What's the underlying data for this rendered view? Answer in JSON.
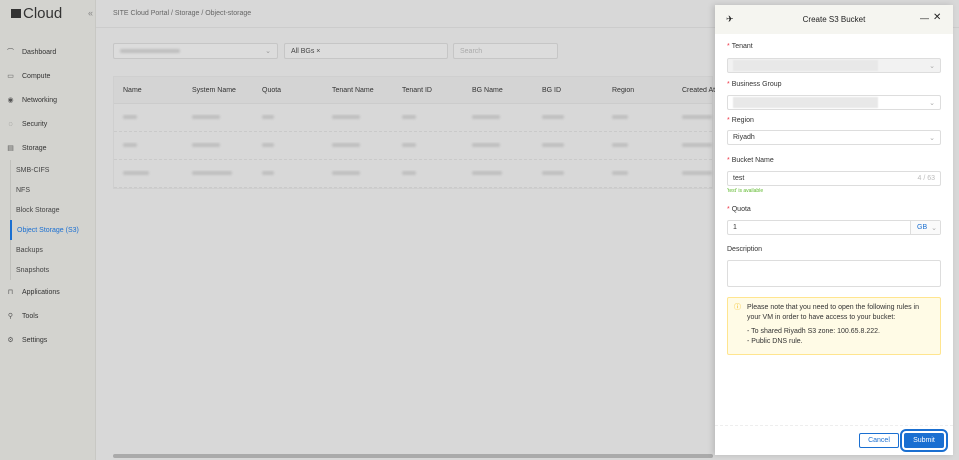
{
  "app": {
    "logo": "Cloud"
  },
  "breadcrumb": "SITE Cloud Portal  /  Storage  /  Object-storage",
  "sidebar": {
    "items": [
      {
        "label": "Dashboard",
        "icon": "chart-icon"
      },
      {
        "label": "Compute",
        "icon": "monitor-icon"
      },
      {
        "label": "Networking",
        "icon": "globe-icon"
      },
      {
        "label": "Security",
        "icon": "shield-icon"
      },
      {
        "label": "Storage",
        "icon": "storage-icon"
      }
    ],
    "storage_sub": [
      "SMB-CIFS",
      "NFS",
      "Block Storage",
      "Object Storage (S3)",
      "Backups",
      "Snapshots"
    ],
    "items2": [
      {
        "label": "Applications",
        "icon": "cart-icon"
      },
      {
        "label": "Tools",
        "icon": "wrench-icon"
      },
      {
        "label": "Settings",
        "icon": "gear-icon"
      }
    ]
  },
  "filters": {
    "bg_tag": "All BGs ×",
    "search_placeholder": "Search"
  },
  "table": {
    "headers": [
      "Name",
      "System Name",
      "Quota",
      "Tenant Name",
      "Tenant ID",
      "BG Name",
      "BG ID",
      "Region",
      "Created At"
    ]
  },
  "panel": {
    "title": "Create S3 Bucket",
    "tenant_label": "Tenant",
    "bg_label": "Business Group",
    "region_label": "Region",
    "region_value": "Riyadh",
    "bucket_label": "Bucket Name",
    "bucket_value": "test",
    "bucket_count": "4 / 63",
    "bucket_hint": "'test' is available",
    "quota_label": "Quota",
    "quota_value": "1",
    "quota_unit": "GB",
    "description_label": "Description",
    "note": [
      "Please note that you need to open the following rules in your VM in order to have access to your bucket:",
      "- To shared Riyadh S3 zone: 100.65.8.222.",
      "- Public DNS rule."
    ],
    "cancel": "Cancel",
    "submit": "Submit"
  }
}
